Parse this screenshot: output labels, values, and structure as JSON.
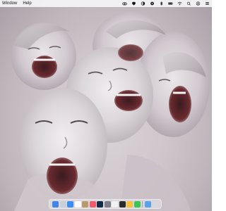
{
  "menubar": {
    "menus": [
      "Window",
      "Help"
    ],
    "status_icons": [
      "creative-cloud-icon",
      "shield-icon",
      "half-circle-icon",
      "eye-icon",
      "bluetooth-icon",
      "battery-icon",
      "wifi-icon",
      "search-icon",
      "user-icon",
      "control-center-icon"
    ]
  },
  "dock": {
    "apps": [
      {
        "name": "finder-icon",
        "color": "#3f86e8"
      },
      {
        "name": "launchpad-icon",
        "color": "#c9cfd9"
      },
      {
        "name": "mail-icon",
        "color": "#3b8ef0"
      },
      {
        "name": "calendar-icon",
        "color": "#ffffff"
      },
      {
        "name": "contacts-icon",
        "color": "#b89a6a"
      },
      {
        "name": "music-icon",
        "color": "#f35a6e"
      },
      {
        "name": "photoshop-icon",
        "color": "#0f2a44"
      },
      {
        "name": "system-settings-icon",
        "color": "#7c7f87"
      },
      {
        "name": "textedit-icon",
        "color": "#f2f2f2"
      },
      {
        "name": "camera-icon",
        "color": "#2b2b2b"
      },
      {
        "name": "photos-icon",
        "color": "#f5c23a"
      },
      {
        "name": "messages-icon",
        "color": "#3cc552"
      },
      {
        "name": "downloads-folder-icon",
        "color": "#5aa3e8"
      },
      {
        "name": "trash-icon",
        "color": "#d7d8dc"
      }
    ]
  }
}
